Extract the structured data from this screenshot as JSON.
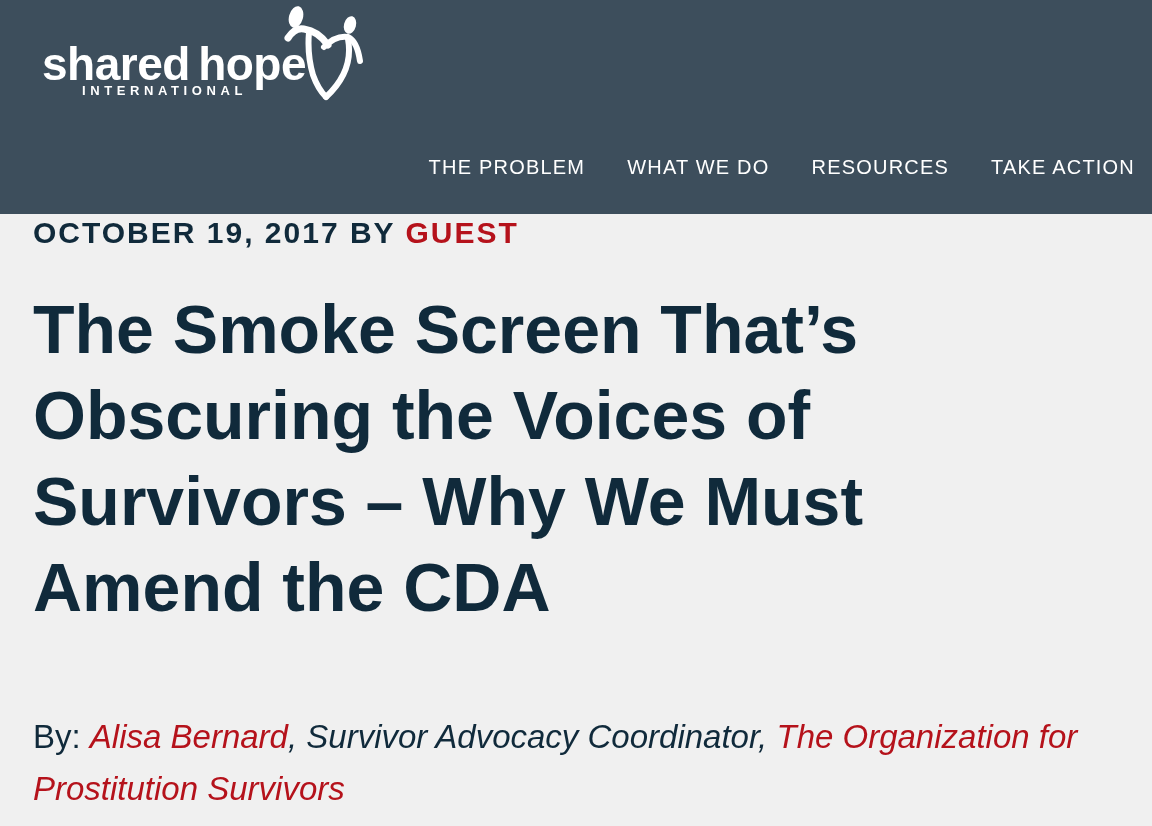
{
  "header": {
    "logo": {
      "name": "shared hope",
      "subtitle": "INTERNATIONAL"
    },
    "nav": [
      {
        "label": "THE PROBLEM"
      },
      {
        "label": "WHAT WE DO"
      },
      {
        "label": "RESOURCES"
      },
      {
        "label": "TAKE ACTION"
      }
    ]
  },
  "post": {
    "date": "OCTOBER 19, 2017",
    "by": "BY",
    "author": "GUEST",
    "title": "The Smoke Screen That’s Obscuring the Voices of Survivors – Why We Must Amend the CDA",
    "byline": [
      {
        "kind": "label",
        "text": "By:"
      },
      {
        "kind": "link",
        "text": "Alisa Bernard"
      },
      {
        "kind": "italic",
        "text": ", Survivor Advocacy Coordinator,"
      },
      {
        "kind": "link",
        "text": "The Organization for"
      },
      {
        "kind": "link",
        "text": "Prostitution Survivors"
      }
    ]
  }
}
